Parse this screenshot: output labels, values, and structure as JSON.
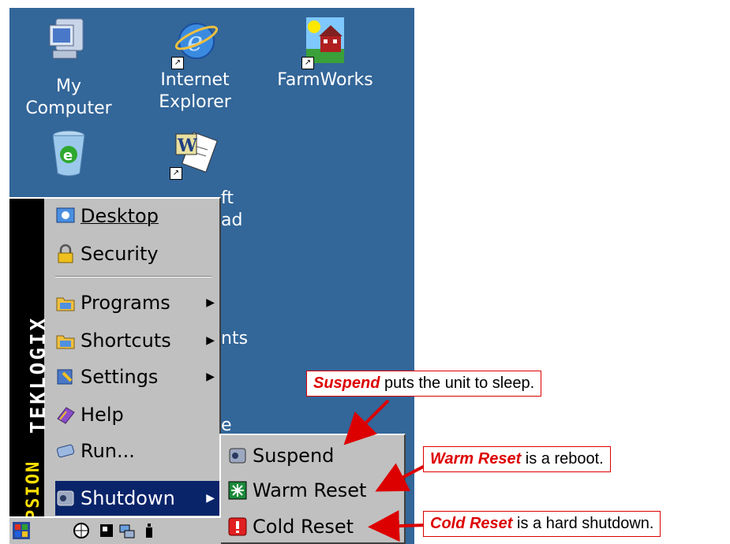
{
  "desktop": {
    "icons": [
      {
        "label_line1": "My",
        "label_line2": "Computer",
        "icon": "my-computer-icon"
      },
      {
        "label_line1": "Internet",
        "label_line2": "Explorer",
        "icon": "internet-explorer-icon"
      },
      {
        "label_line1": "FarmWorks",
        "label_line2": "",
        "icon": "farmworks-icon"
      },
      {
        "label_line1": "",
        "label_line2": "",
        "icon": "recycle-bin-icon"
      },
      {
        "label_line1": "",
        "label_line2": "",
        "icon": "microsoft-wordpad-icon"
      }
    ],
    "partial_labels": [
      "ft",
      "ad",
      "nts",
      "e"
    ]
  },
  "start_menu": {
    "brand": "TEKLOGIX",
    "brand_psion": "PSION",
    "items": [
      {
        "label": "Desktop",
        "has_submenu": false,
        "icon": "desktop-icon"
      },
      {
        "label": "Security",
        "has_submenu": false,
        "icon": "lock-icon"
      },
      {
        "label": "Programs",
        "has_submenu": true,
        "icon": "folder-icon"
      },
      {
        "label": "Shortcuts",
        "has_submenu": true,
        "icon": "folder-icon"
      },
      {
        "label": "Settings",
        "has_submenu": true,
        "icon": "settings-icon"
      },
      {
        "label": "Help",
        "has_submenu": false,
        "icon": "help-book-icon"
      },
      {
        "label": "Run...",
        "has_submenu": false,
        "icon": "run-icon"
      },
      {
        "label": "Shutdown",
        "has_submenu": true,
        "icon": "shutdown-icon",
        "selected": true
      }
    ]
  },
  "shutdown_submenu": {
    "items": [
      {
        "label": "Suspend",
        "icon": "suspend-icon"
      },
      {
        "label": "Warm Reset",
        "icon": "warm-reset-icon"
      },
      {
        "label": "Cold Reset",
        "icon": "cold-reset-icon"
      }
    ]
  },
  "callouts": [
    {
      "keyword": "Suspend",
      "text": " puts the unit to sleep."
    },
    {
      "keyword": "Warm Reset",
      "text": " is a reboot."
    },
    {
      "keyword": "Cold Reset",
      "text": " is a hard shutdown."
    }
  ],
  "colors": {
    "desktop_bg": "#336699",
    "menu_bg": "#c0c0c0",
    "selection": "#0a246a",
    "callout_red": "#dd0000"
  }
}
